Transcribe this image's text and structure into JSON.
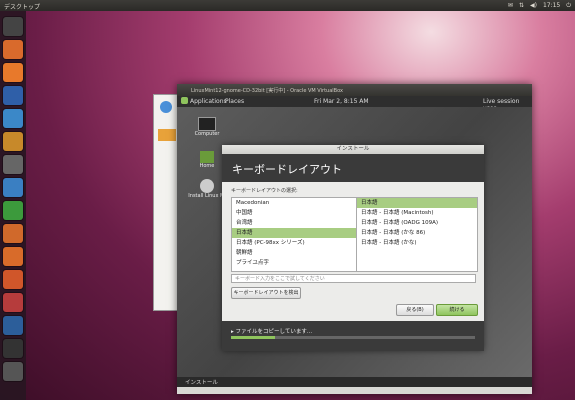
{
  "topbar": {
    "title": "デスクトップ",
    "time": "17:15",
    "tray": [
      "✉",
      "⇅",
      "◀)"
    ]
  },
  "launcher": {
    "items": [
      {
        "name": "ubuntu-home-icon",
        "color": "#444"
      },
      {
        "name": "files-icon",
        "color": "#d96a2c"
      },
      {
        "name": "firefox-icon",
        "color": "#e8792b"
      },
      {
        "name": "thunderbird-icon",
        "color": "#2f5fa8"
      },
      {
        "name": "empathy-icon",
        "color": "#3b88c8"
      },
      {
        "name": "rhythmbox-icon",
        "color": "#c7892a"
      },
      {
        "name": "shotwell-icon",
        "color": "#666"
      },
      {
        "name": "writer-icon",
        "color": "#3a7fc2"
      },
      {
        "name": "calc-icon",
        "color": "#3c9a3c"
      },
      {
        "name": "impress-icon",
        "color": "#d0692b"
      },
      {
        "name": "software-center-icon",
        "color": "#d86b2a"
      },
      {
        "name": "ubuntu-one-icon",
        "color": "#d0562a"
      },
      {
        "name": "settings-icon",
        "color": "#b63c3c"
      },
      {
        "name": "virtualbox-icon",
        "color": "#2c5e9a"
      },
      {
        "name": "terminal-icon",
        "color": "#333"
      },
      {
        "name": "trash-icon",
        "color": "#555"
      }
    ]
  },
  "vbox": {
    "title": "LinuxMint12-gnome-CD-32bit [実行中] - Oracle VM VirtualBox",
    "panel": {
      "applications": "Applications",
      "places": "Places",
      "clock": "Fri Mar  2,  8:15 AM",
      "user": "Live session user"
    },
    "desktop_icons": [
      {
        "label": "Computer",
        "name": "computer-icon"
      },
      {
        "label": "Home",
        "name": "home-icon"
      },
      {
        "label": "Install Linux Mi",
        "name": "install-disc-icon"
      }
    ],
    "taskbar_item": "インストール"
  },
  "installer": {
    "window_title": "インストール",
    "heading": "キーボードレイアウト",
    "choose_label": "キーボードレイアウトの選択:",
    "layouts": [
      "Macedonian",
      "中国語",
      "台湾語",
      "日本語",
      "日本語 (PC-98xx シリーズ)",
      "朝鮮語",
      "プライユ点字"
    ],
    "selected_layout": 3,
    "variants": [
      "日本語",
      "日本語 - 日本語 (Macintosh)",
      "日本語 - 日本語 (OADG 109A)",
      "日本語 - 日本語 (かな 86)",
      "日本語 - 日本語 (かな)"
    ],
    "selected_variant": 0,
    "test_placeholder": "キーボード入力をここで試してください",
    "detect_button": "キーボードレイアウトを検出",
    "back_button": "戻る(B)",
    "forward_button": "続ける",
    "status_text": "▸ ファイルをコピーしています...",
    "progress": 0.18
  }
}
